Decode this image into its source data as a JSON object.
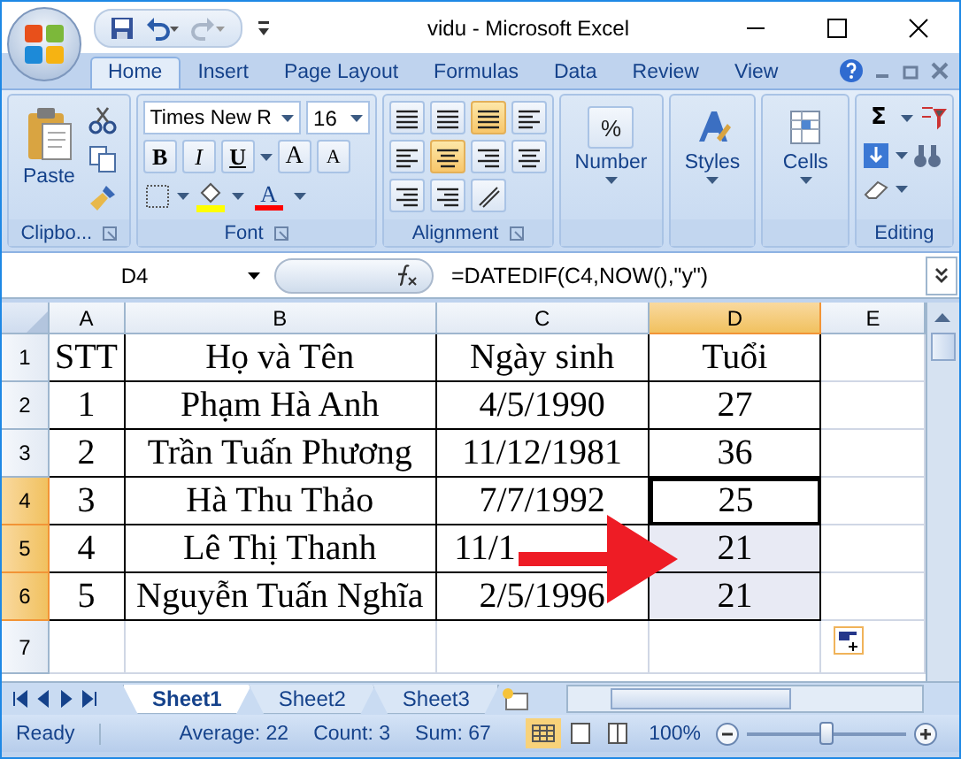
{
  "window": {
    "title": "vidu - Microsoft Excel"
  },
  "tabs": [
    {
      "label": "Home",
      "selected": true
    },
    {
      "label": "Insert",
      "selected": false
    },
    {
      "label": "Page Layout",
      "selected": false
    },
    {
      "label": "Formulas",
      "selected": false
    },
    {
      "label": "Data",
      "selected": false
    },
    {
      "label": "Review",
      "selected": false
    },
    {
      "label": "View",
      "selected": false
    }
  ],
  "ribbon": {
    "clipboard": {
      "paste": "Paste",
      "label": "Clipbo..."
    },
    "font": {
      "name": "Times New R",
      "size": "16",
      "style_buttons": [
        "B",
        "I",
        "U"
      ],
      "grow_shrink": [
        "A",
        "A"
      ],
      "color_letter": "A",
      "label": "Font"
    },
    "alignment": {
      "label": "Alignment"
    },
    "number": {
      "icon": "%",
      "label": "Number"
    },
    "styles": {
      "label": "Styles"
    },
    "cells": {
      "label": "Cells"
    },
    "editing": {
      "sum": "Σ",
      "label": "Editing"
    }
  },
  "formula_bar": {
    "name_box": "D4",
    "formula": "=DATEDIF(C4,NOW(),\"y\")"
  },
  "columns": [
    {
      "label": "A",
      "selected": false
    },
    {
      "label": "B",
      "selected": false
    },
    {
      "label": "C",
      "selected": false
    },
    {
      "label": "D",
      "selected": true
    },
    {
      "label": "E",
      "selected": false
    }
  ],
  "rows": [
    {
      "number": "1",
      "selected": false,
      "cells": [
        "STT",
        "Họ và Tên",
        "Ngày sinh",
        "Tuổi",
        ""
      ]
    },
    {
      "number": "2",
      "selected": false,
      "cells": [
        "1",
        "Phạm Hà Anh",
        "4/5/1990",
        "27",
        ""
      ]
    },
    {
      "number": "3",
      "selected": false,
      "cells": [
        "2",
        "Trần Tuấn Phương",
        "11/12/1981",
        "36",
        ""
      ]
    },
    {
      "number": "4",
      "selected": true,
      "cells": [
        "3",
        "Hà Thu Thảo",
        "7/7/1992",
        "25",
        ""
      ]
    },
    {
      "number": "5",
      "selected": true,
      "arrow": true,
      "cells": [
        "4",
        "Lê Thị Thanh",
        "11/1",
        "21",
        ""
      ]
    },
    {
      "number": "6",
      "selected": true,
      "cells": [
        "5",
        "Nguyễn Tuấn Nghĩa",
        "2/5/1996",
        "21",
        ""
      ]
    },
    {
      "number": "7",
      "selected": false,
      "cells": [
        "",
        "",
        "",
        "",
        ""
      ]
    }
  ],
  "sheets": [
    {
      "label": "Sheet1",
      "selected": true
    },
    {
      "label": "Sheet2",
      "selected": false
    },
    {
      "label": "Sheet3",
      "selected": false
    }
  ],
  "status_bar": {
    "mode": "Ready",
    "stats": [
      "Average: 22",
      "Count: 3",
      "Sum: 67"
    ],
    "zoom": "100%",
    "zoom_level": {
      "level": 0.5
    }
  }
}
